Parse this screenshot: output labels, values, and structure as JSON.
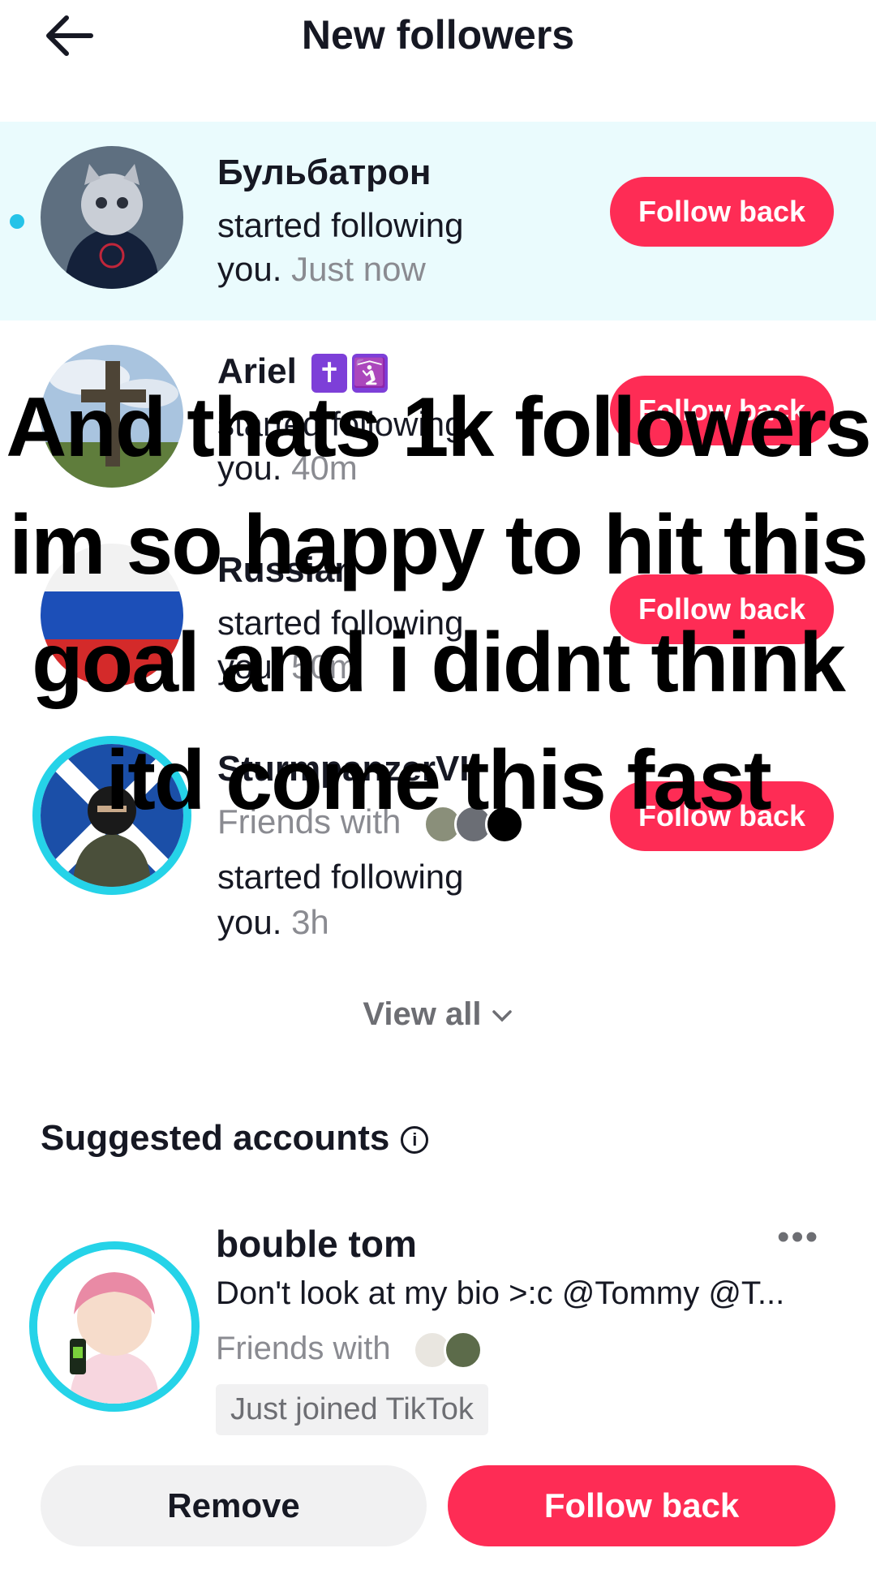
{
  "header": {
    "title": "New followers",
    "back_icon": "arrow-left-icon"
  },
  "followers": [
    {
      "name": "Бульбатрон",
      "action": "started following",
      "you": "you.",
      "time": "Just now",
      "button": "Follow back",
      "unread": true
    },
    {
      "name": "Ariel",
      "emoji": [
        "✝",
        "🛐"
      ],
      "action": "started following",
      "you": "you.",
      "time": "40m",
      "button": "Follow back"
    },
    {
      "name": "Russian",
      "action": "started following",
      "you": "you.",
      "time": "50m",
      "button": "Follow back"
    },
    {
      "name": "SturmpanzerVII",
      "friends_label": "Friends with",
      "action": "started following",
      "you": "you.",
      "time": "3h",
      "button": "Follow back"
    }
  ],
  "view_all": "View all",
  "suggested": {
    "title": "Suggested accounts",
    "account": {
      "name": "bouble tom",
      "bio": "Don't look at my bio >:c @Tommy @T...",
      "friends_label": "Friends with",
      "tag": "Just joined TikTok"
    },
    "remove_label": "Remove",
    "follow_label": "Follow back"
  },
  "overlay_caption": [
    "And thats 1k followers",
    "im so happy to hit this",
    "goal and i didnt think",
    "itd come this fast"
  ],
  "colors": {
    "accent": "#fe2c55",
    "unread_bg": "#eafbfd",
    "ring": "#25d3e8"
  }
}
